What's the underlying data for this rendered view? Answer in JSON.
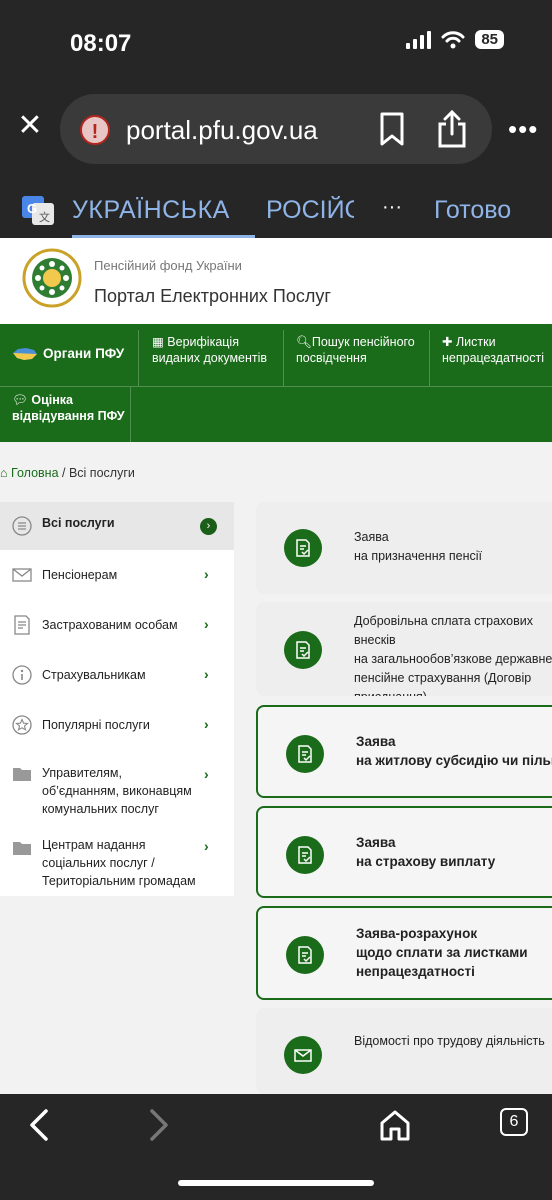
{
  "status": {
    "time": "08:07",
    "battery": "85"
  },
  "browser": {
    "url": "portal.pfu.gov.ua"
  },
  "translate": {
    "active_lang": "УКРАЇНСЬКА",
    "other_lang": "РОСІЙСЬКА",
    "more": "···",
    "done": "Готово"
  },
  "site": {
    "subtitle": "Пенсійний фонд України",
    "title": "Портал Електронних Послуг"
  },
  "nav": {
    "items": [
      {
        "label": "Органи ПФУ"
      },
      {
        "label": "Верифікація виданих документів"
      },
      {
        "label": "Пошук пенсійного посвідчення"
      },
      {
        "label": "Листки непрацездатності"
      },
      {
        "label": "Оцінка відвідування ПФУ"
      }
    ]
  },
  "breadcrumb": {
    "home": "Головна",
    "separator": " / ",
    "current": "Всі послуги"
  },
  "sidebar": {
    "items": [
      {
        "label": "Всі послуги",
        "icon": "list-icon"
      },
      {
        "label": "Пенсіонерам",
        "icon": "envelope-icon"
      },
      {
        "label": "Застрахованим особам",
        "icon": "document-icon"
      },
      {
        "label": "Страхувальникам",
        "icon": "info-icon"
      },
      {
        "label": "Популярні послуги",
        "icon": "star-icon"
      },
      {
        "label": "Управителям, об’єднанням, виконавцям комунальних послуг",
        "icon": "folder-icon"
      },
      {
        "label": "Центрам надання соціальних послуг / Територіальним громадам",
        "icon": "folder-icon"
      }
    ]
  },
  "cards": [
    {
      "text": "Заява\nна призначення пенсії"
    },
    {
      "text": "Добровільна сплата страхових внесків\nна загальнообов’язкове державне\nпенсійне страхування (Договір\nприєднання)"
    },
    {
      "text": "Заява\nна житлову субсидію чи пільгу"
    },
    {
      "text": "Заява\nна страхову виплату"
    },
    {
      "text": "Заява-розрахунок\nщодо сплати за листками\nнепрацездатності"
    },
    {
      "text": "Відомості про трудову діяльність"
    }
  ],
  "toolbar": {
    "tabs_count": "6"
  },
  "colors": {
    "brand_green": "#1a6b1a",
    "browser_dark": "#262626",
    "link_blue": "#8fb4e8"
  }
}
